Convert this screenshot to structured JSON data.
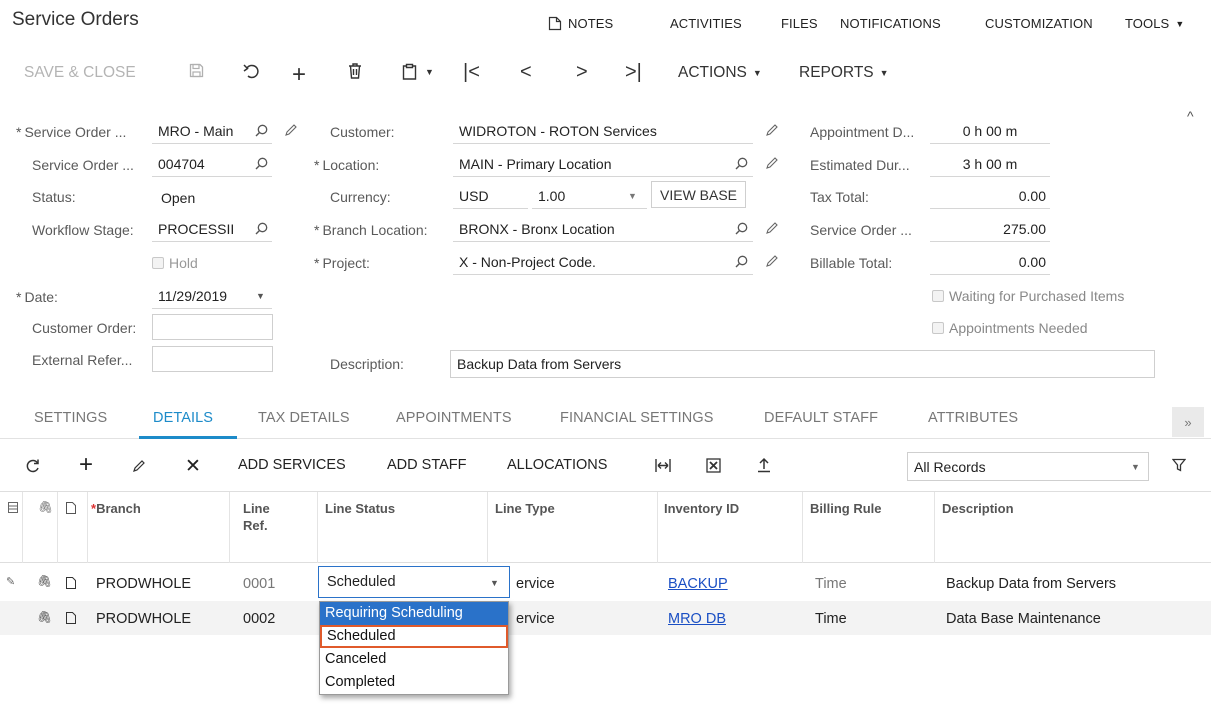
{
  "header": {
    "title": "Service Orders",
    "nav": [
      "NOTES",
      "ACTIVITIES",
      "FILES",
      "NOTIFICATIONS",
      "CUSTOMIZATION",
      "TOOLS"
    ]
  },
  "toolbar": {
    "save_close": "SAVE & CLOSE",
    "actions": "ACTIONS",
    "reports": "REPORTS"
  },
  "form": {
    "left": {
      "service_order_type_label": "Service Order ...",
      "service_order_type_value": "MRO - Main",
      "service_order_nbr_label": "Service Order ...",
      "service_order_nbr_value": "004704",
      "status_label": "Status:",
      "status_value": "Open",
      "workflow_label": "Workflow Stage:",
      "workflow_value": "PROCESSII",
      "hold_label": "Hold",
      "date_label": "Date:",
      "date_value": "11/29/2019",
      "customer_order_label": "Customer Order:",
      "external_ref_label": "External Refer..."
    },
    "middle": {
      "customer_label": "Customer:",
      "customer_value": "WIDROTON - ROTON Services",
      "location_label": "Location:",
      "location_value": "MAIN - Primary Location",
      "currency_label": "Currency:",
      "currency_value": "USD",
      "rate_value": "1.00",
      "view_base": "VIEW BASE",
      "branch_location_label": "Branch Location:",
      "branch_location_value": "BRONX - Bronx Location",
      "project_label": "Project:",
      "project_value": "X - Non-Project Code.",
      "description_label": "Description:",
      "description_value": "Backup Data from Servers"
    },
    "right": {
      "appointment_label": "Appointment D...",
      "appointment_value": "0 h 00 m",
      "estimated_label": "Estimated Dur...",
      "estimated_value": "3 h 00 m",
      "tax_label": "Tax Total:",
      "tax_value": "0.00",
      "so_total_label": "Service Order ...",
      "so_total_value": "275.00",
      "billable_label": "Billable Total:",
      "billable_value": "0.00",
      "waiting_label": "Waiting for Purchased Items",
      "appointments_needed_label": "Appointments Needed"
    }
  },
  "tabs": [
    "SETTINGS",
    "DETAILS",
    "TAX DETAILS",
    "APPOINTMENTS",
    "FINANCIAL SETTINGS",
    "DEFAULT STAFF",
    "ATTRIBUTES"
  ],
  "grid_toolbar": {
    "add_services": "ADD SERVICES",
    "add_staff": "ADD STAFF",
    "allocations": "ALLOCATIONS",
    "filter_value": "All Records"
  },
  "grid": {
    "columns": {
      "branch": "Branch",
      "line_ref_1": "Line",
      "line_ref_2": "Ref.",
      "line_status": "Line Status",
      "line_type": "Line Type",
      "inventory_id": "Inventory ID",
      "billing_rule": "Billing Rule",
      "description": "Description"
    },
    "rows": [
      {
        "branch": "PRODWHOLE",
        "line_ref": "0001",
        "line_status": "Scheduled",
        "line_type": "ervice",
        "inventory_id": "BACKUP",
        "billing_rule": "Time",
        "description": "Backup Data from Servers"
      },
      {
        "branch": "PRODWHOLE",
        "line_ref": "0002",
        "line_status": "",
        "line_type": "ervice",
        "inventory_id": "MRO DB",
        "billing_rule": "Time",
        "description": "Data Base Maintenance"
      }
    ]
  },
  "dropdown": {
    "options": [
      "Requiring Scheduling",
      "Scheduled",
      "Canceled",
      "Completed"
    ],
    "highlighted": "Requiring Scheduling",
    "selected": "Scheduled"
  },
  "colors": {
    "accent": "#1d8bc9",
    "link": "#1a4fc4",
    "dropdown_highlight": "#2a72c9",
    "selection_outline": "#e05a2b"
  }
}
